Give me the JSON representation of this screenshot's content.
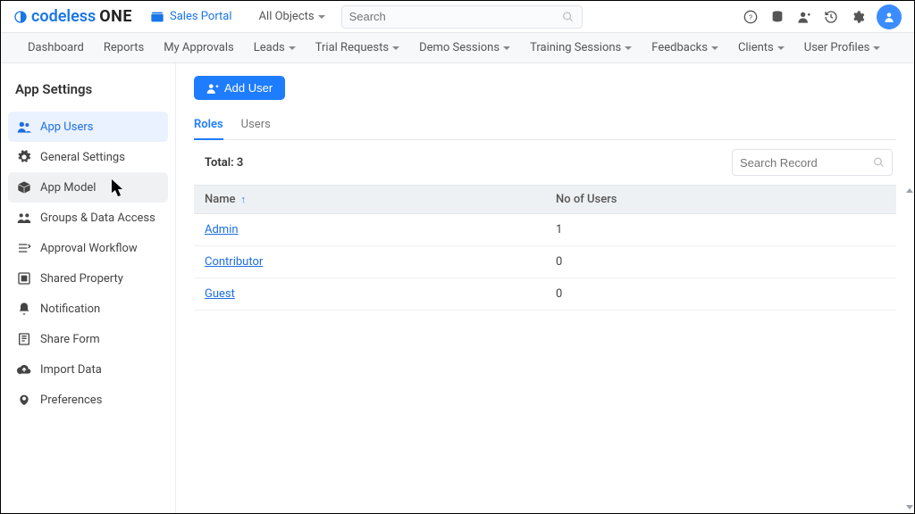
{
  "brand": {
    "prefix": "codeless",
    "suffix": "ONE"
  },
  "portal_name": "Sales Portal",
  "object_selector": "All Objects",
  "global_search_placeholder": "Search",
  "nav": [
    "Dashboard",
    "Reports",
    "My Approvals",
    "Leads",
    "Trial Requests",
    "Demo Sessions",
    "Training Sessions",
    "Feedbacks",
    "Clients",
    "User Profiles"
  ],
  "nav_has_caret": [
    false,
    false,
    false,
    true,
    true,
    true,
    true,
    true,
    true,
    true
  ],
  "sidebar_title": "App Settings",
  "sidebar_items": [
    {
      "label": "App Users",
      "active": true
    },
    {
      "label": "General Settings"
    },
    {
      "label": "App Model",
      "hover": true
    },
    {
      "label": "Groups & Data Access"
    },
    {
      "label": "Approval Workflow"
    },
    {
      "label": "Shared Property"
    },
    {
      "label": "Notification"
    },
    {
      "label": "Share Form"
    },
    {
      "label": "Import Data"
    },
    {
      "label": "Preferences"
    }
  ],
  "add_button": "Add User",
  "tabs": [
    {
      "label": "Roles",
      "active": true
    },
    {
      "label": "Users"
    }
  ],
  "total_label": "Total:",
  "total_count": "3",
  "record_search_placeholder": "Search Record",
  "columns": [
    "Name",
    "No of Users"
  ],
  "rows": [
    {
      "name": "Admin",
      "count": "1"
    },
    {
      "name": "Contributor",
      "count": "0"
    },
    {
      "name": "Guest",
      "count": "0"
    }
  ]
}
